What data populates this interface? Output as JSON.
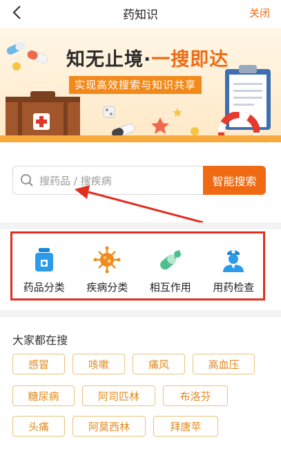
{
  "header": {
    "title": "药知识",
    "back_icon": "chevron-left-icon",
    "close_label": "关闭"
  },
  "banner": {
    "headline_part1": "知无止境",
    "headline_sep": "·",
    "headline_part2": "一搜即达",
    "subtitle": "实现高效搜索与知识共享"
  },
  "search": {
    "placeholder": "搜药品 / 搜疾病",
    "button_label": "智能搜索",
    "icon": "search-icon"
  },
  "categories": [
    {
      "label": "药品分类",
      "icon": "medicine-bottle-icon"
    },
    {
      "label": "疾病分类",
      "icon": "virus-icon"
    },
    {
      "label": "相互作用",
      "icon": "pill-interaction-icon"
    },
    {
      "label": "用药检查",
      "icon": "doctor-icon"
    }
  ],
  "popular": {
    "title": "大家都在搜",
    "tags": [
      "感冒",
      "咳嗽",
      "痛风",
      "高血压",
      "糖尿病",
      "阿司匹林",
      "布洛芬",
      "头痛",
      "阿莫西林",
      "拜唐苹"
    ]
  },
  "colors": {
    "accent": "#f06a13",
    "annotation": "#e02e20",
    "tag_text": "#e08a1f",
    "tag_border": "#e8c27a"
  }
}
